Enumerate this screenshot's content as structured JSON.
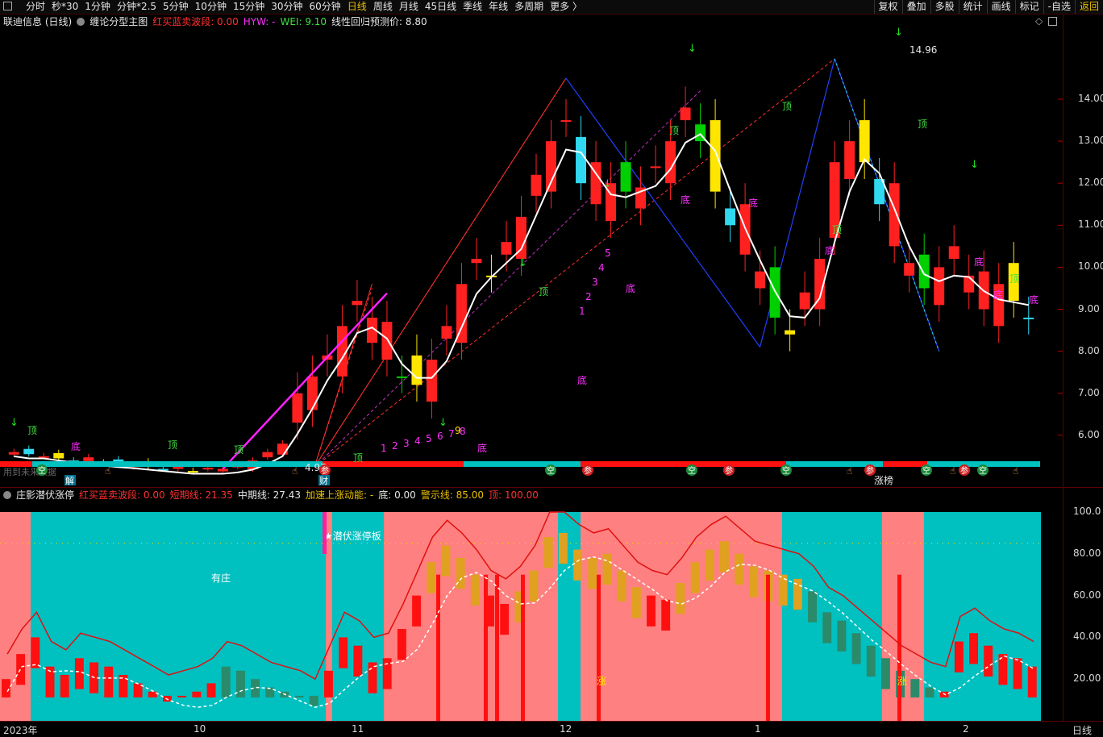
{
  "toolbar": {
    "tabs": [
      "分时",
      "秒*30",
      "1分钟",
      "分钟*2.5",
      "5分钟",
      "10分钟",
      "15分钟",
      "30分钟",
      "60分钟",
      "日线",
      "周线",
      "月线",
      "45日线",
      "季线",
      "年线",
      "多周期",
      "更多 〉"
    ],
    "active_tab": "日线",
    "right_buttons": [
      "复权",
      "叠加",
      "多股",
      "统计",
      "画线",
      "标记",
      "-自选",
      "返回"
    ]
  },
  "main_info": {
    "stock": "联迪信息 (日线)",
    "indicator": "缠论分型主图",
    "hong_mai": "红买蓝卖波段: 0.00",
    "hyw": "HYW: -",
    "wei": "WEI: 9.10",
    "forecast": "线性回归预测价: 8.80"
  },
  "sub_info": {
    "indicator": "庄影潜伏涨停",
    "hong_mai": "红买蓝卖波段: 0.00",
    "short": "短期线: 21.35",
    "mid": "中期线: 27.43",
    "accel": "加速上涨动能: -",
    "bottom": "底: 0.00",
    "warn": "警示线: 85.00",
    "top": "顶: 100.00"
  },
  "price_axis": [
    "14.00",
    "13.00",
    "12.00",
    "11.00",
    "10.00",
    "9.00",
    "8.00",
    "7.00",
    "6.00"
  ],
  "sub_axis": [
    "100.0",
    "80.00",
    "60.00",
    "40.00",
    "20.00"
  ],
  "date_axis": [
    "2023年",
    "10",
    "11",
    "12",
    "1",
    "2"
  ],
  "period_label": "日线",
  "annotations": {
    "high_price": "14.96",
    "low_price": "4.97",
    "top_mark": "顶",
    "bottom_mark": "底",
    "jie": "解",
    "cai": "财",
    "you_zhuang": "有庄",
    "qianfu": "★潜伏涨停板",
    "zhang": "涨",
    "zhang_bang": "涨榜",
    "future_text": "用到未来数据",
    "kong": "空",
    "can": "参",
    "nine": "9",
    "count_nums": [
      "1",
      "2",
      "3",
      "4",
      "5",
      "6",
      "7",
      "8"
    ]
  },
  "colors": {
    "up": "#ff2020",
    "down": "#00d000",
    "yellow": "#ffe600",
    "cyan": "#30d8f0",
    "magenta": "#ff20ff",
    "zone_pink": "#ff8080",
    "zone_cyan": "#00c0c0"
  },
  "chart_data": {
    "type": "candlestick",
    "ylim": [
      5.0,
      15.0
    ],
    "high": 14.96,
    "low": 4.97,
    "close_trend": [
      5.6,
      5.55,
      5.5,
      5.45,
      5.4,
      5.38,
      5.35,
      5.3,
      5.3,
      5.25,
      5.2,
      5.2,
      5.15,
      5.2,
      5.2,
      5.25,
      5.4,
      5.6,
      5.8,
      7.0,
      7.4,
      7.8,
      8.6,
      9.2,
      8.2,
      7.8,
      7.4,
      7.2,
      7.8,
      8.6,
      9.6,
      10.2,
      9.8,
      10.6,
      11.2,
      12.2,
      13.0,
      13.5,
      12.0,
      11.5,
      12.0,
      11.8,
      11.9,
      12.4,
      13.0,
      13.8,
      13.0,
      11.8,
      11.0,
      10.3,
      9.5,
      8.8,
      8.5,
      9.4,
      10.2,
      12.5,
      13.0,
      12.5,
      11.5,
      10.5,
      9.8,
      9.5,
      10.0,
      10.2,
      9.4,
      9.0,
      9.6,
      9.2,
      8.8
    ]
  }
}
